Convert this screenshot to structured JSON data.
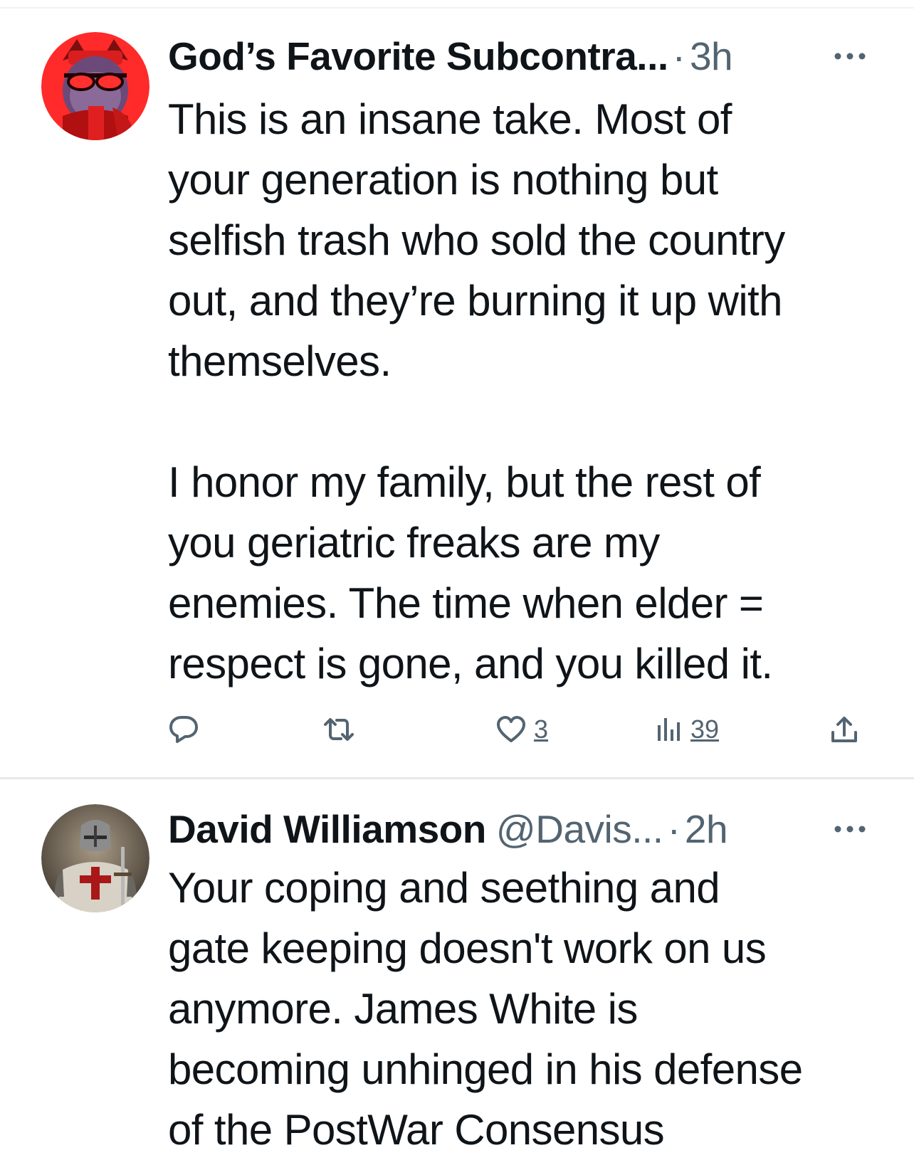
{
  "tweets": [
    {
      "display_name": "God’s Favorite Subcontra...",
      "handle": "",
      "separator": "·",
      "time": "3h",
      "text": "This is an insane take. Most of\nyour generation is nothing but\nselfish trash who sold the country\nout, and they’re burning it up with\nthemselves.\n\nI honor my family, but the rest of\nyou geriatric freaks are my\nenemies. The time when elder =\nrespect is gone, and you killed it.",
      "avatar_icon": "red-cartoon-avatar",
      "actions": {
        "reply_count": "",
        "retweet_count": "",
        "like_count": "3",
        "views_count": "39"
      }
    },
    {
      "display_name": "David Williamson",
      "handle": "@Davis...",
      "separator": "·",
      "time": "2h",
      "text": "Your coping and seething and\ngate keeping doesn't work on us\nanymore. James White is\nbecoming unhinged in his defense\nof the PostWar Consensus",
      "avatar_icon": "knight-avatar"
    }
  ],
  "colors": {
    "text_primary": "#0f1419",
    "text_secondary": "#536471",
    "divider": "#eff3f4",
    "background": "#ffffff"
  },
  "icons": {
    "more": "more-horizontal-icon",
    "reply": "reply-icon",
    "retweet": "retweet-icon",
    "like": "heart-icon",
    "views": "views-chart-icon",
    "share": "share-icon"
  }
}
